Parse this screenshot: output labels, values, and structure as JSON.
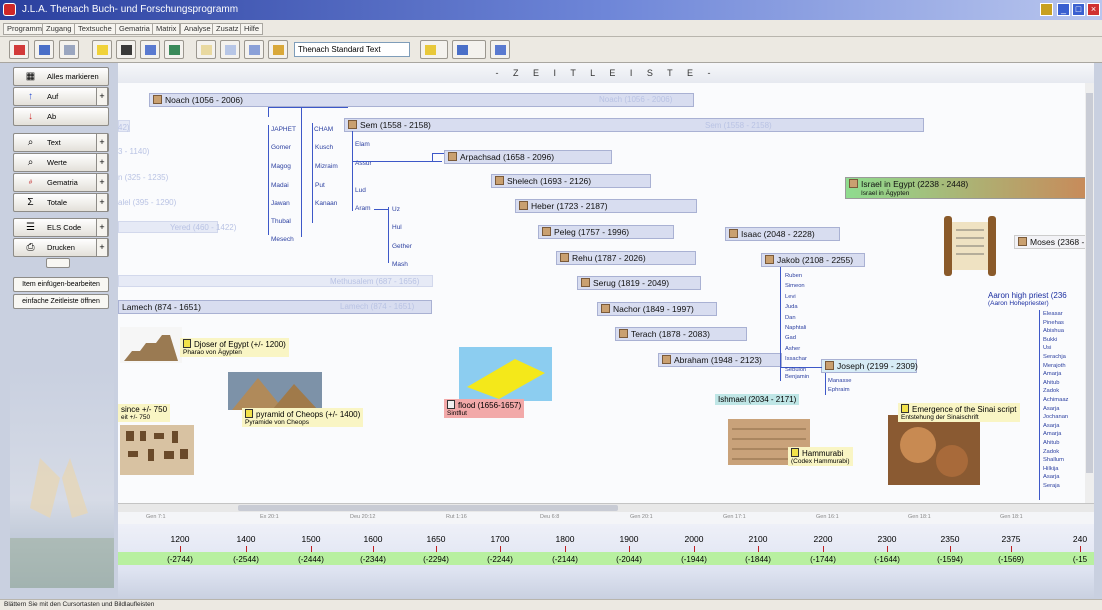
{
  "window": {
    "title": "J.L.A. Thenach Buch- und Forschungsprogramm"
  },
  "menu": [
    "Programm",
    "Zugang",
    "Textsuche",
    "Gematria",
    "Matrix",
    "Analyse",
    "Zusatz",
    "Hilfe"
  ],
  "toolbar": {
    "text_select": "Thenach Standard Text"
  },
  "left_panel": {
    "buttons": [
      {
        "label": "Alles markieren",
        "icon": "grid-icon"
      },
      {
        "label": "Auf",
        "icon": "arrow-up-icon"
      },
      {
        "label": "Ab",
        "icon": "arrow-down-icon"
      },
      {
        "label": "Text",
        "icon": "text-search-icon"
      },
      {
        "label": "Werte",
        "icon": "value-search-icon"
      },
      {
        "label": "Gematria",
        "icon": "gematria-icon"
      },
      {
        "label": "Totale",
        "icon": "totals-icon"
      },
      {
        "label": "ELS Code",
        "icon": "els-code-icon"
      },
      {
        "label": "Drucken",
        "icon": "printer-icon"
      }
    ],
    "small_buttons": [
      "Item einfügen-bearbeiten",
      "einfache Zeitleiste öffnen"
    ]
  },
  "timeline": {
    "header": "- Z E I T L E I S T E -",
    "persons": [
      {
        "label": "Noach (1056 - 2006)"
      },
      {
        "label": "Sem (1558 - 2158)"
      },
      {
        "label": "Arpachsad (1658 - 2096)"
      },
      {
        "label": "Shelech (1693 - 2126)"
      },
      {
        "label": "Heber (1723 - 2187)"
      },
      {
        "label": "Peleg (1757 - 1996)"
      },
      {
        "label": "Rehu (1787 - 2026)"
      },
      {
        "label": "Serug (1819 - 2049)"
      },
      {
        "label": "Nachor (1849 - 1997)"
      },
      {
        "label": "Terach (1878 - 2083)"
      },
      {
        "label": "Abraham (1948 - 2123)"
      },
      {
        "label": "Isaac (2048 - 2228)"
      },
      {
        "label": "Jakob (2108 - 2255)"
      },
      {
        "label": "Joseph (2199 - 2309)"
      },
      {
        "label": "Moses (2368 - 24"
      },
      {
        "label": "Lamech (874 - 1651)"
      }
    ],
    "faint_labels": {
      "noach": "Noach (1056 - 2006)",
      "sem": "Sem (1558 - 2158)",
      "lamech": "Lamech (874 - 1651)",
      "methusalem": "Methusalem (687 - 1656)",
      "f1": "42)",
      "f2": "3 - 1140)",
      "f3": "n (325 - 1235)",
      "f4": "alel (395 - 1290)",
      "f5": "Yered (460 - 1422)"
    },
    "sons_noah": {
      "japhet": "JAPHET",
      "cham": "CHAM",
      "japhet_children": [
        "Gomer",
        "Magog",
        "Madai",
        "Jawan",
        "Thubal",
        "Mesech"
      ],
      "cham_children": [
        "Kusch",
        "Mizraim",
        "Put",
        "Kanaan"
      ],
      "sem_children": [
        "Elam",
        "Assur",
        "Lud",
        "Aram"
      ],
      "aram_children": [
        "Uz",
        "Hul",
        "Gether",
        "Mash"
      ]
    },
    "jakob_sons": [
      "Ruben",
      "Simeon",
      "Levi",
      "Juda",
      "Dan",
      "Naphtali",
      "Gad",
      "Asher",
      "Issachar",
      "Sebulon",
      "Benjamin"
    ],
    "joseph_sons": [
      "Manasse",
      "Ephraim"
    ],
    "ishmael": "Ishmael (2034 - 2171)",
    "israel_egypt": {
      "title": "Israel in Egypt (2238 - 2448)",
      "subtitle": "Israel in Ägypten"
    },
    "aaron": {
      "title": "Aaron high priest (236",
      "subtitle": "(Aaron Hohepriester)"
    },
    "aaron_line": [
      "Eleasar",
      "Pinehas",
      "Abishua",
      "Bukki",
      "Usi",
      "Serachja",
      "Merajoth",
      "Amarja",
      "Ahitub",
      "Zadok",
      "Achimaaz",
      "Asarja",
      "Jochanan",
      "Asarja",
      "Amarja",
      "Ahitub",
      "Zadok",
      "Shallum",
      "Hilkija",
      "Asarja",
      "Seraja"
    ],
    "events": [
      {
        "title": "Djoser of Egypt (+/- 1200)",
        "subtitle": "Pharao von Ägypten"
      },
      {
        "title": "pyramid of Cheops (+/- 1400)",
        "subtitle": "Pyramide von Cheops"
      },
      {
        "title": "flood (1656-1657)",
        "subtitle": "Sintflut"
      },
      {
        "title": "Hammurabi",
        "subtitle": "(Codex Hammurabi)"
      },
      {
        "title": "Emergence of the Sinai script",
        "subtitle": "Entstehung der Sinaischrift"
      },
      {
        "title": "since +/- 750",
        "subtitle": "eit +/- 750"
      }
    ]
  },
  "generations": [
    "Gen 7:1",
    "Ex 20:1",
    "Deu 20:12",
    "Rut 1:16",
    "Deu 6:8",
    "Gen 20:1",
    "Gen 17:1",
    "Gen 16:1",
    "Gen 18:1",
    "Gen 18:1"
  ],
  "years": [
    "1200",
    "1400",
    "1500",
    "1600",
    "1650",
    "1700",
    "1800",
    "1900",
    "2000",
    "2100",
    "2200",
    "2300",
    "2350",
    "2375",
    "240"
  ],
  "years_bc": [
    "(-2744)",
    "(-2544)",
    "(-2444)",
    "(-2344)",
    "(-2294)",
    "(-2244)",
    "(-2144)",
    "(-2044)",
    "(-1944)",
    "(-1844)",
    "(-1744)",
    "(-1644)",
    "(-1594)",
    "(-1569)",
    "(-15"
  ],
  "status_text": "Blättern Sie mit den Cursortasten und Bildlaufleisten",
  "colors": {
    "title_bar": "#2a3f9e",
    "bar": "#d8ddf0",
    "event_yellow": "#f9f5c4",
    "flood": "#f2a9a9",
    "ishmael": "#bfe6e6",
    "years_green": "#b8f0a0"
  }
}
